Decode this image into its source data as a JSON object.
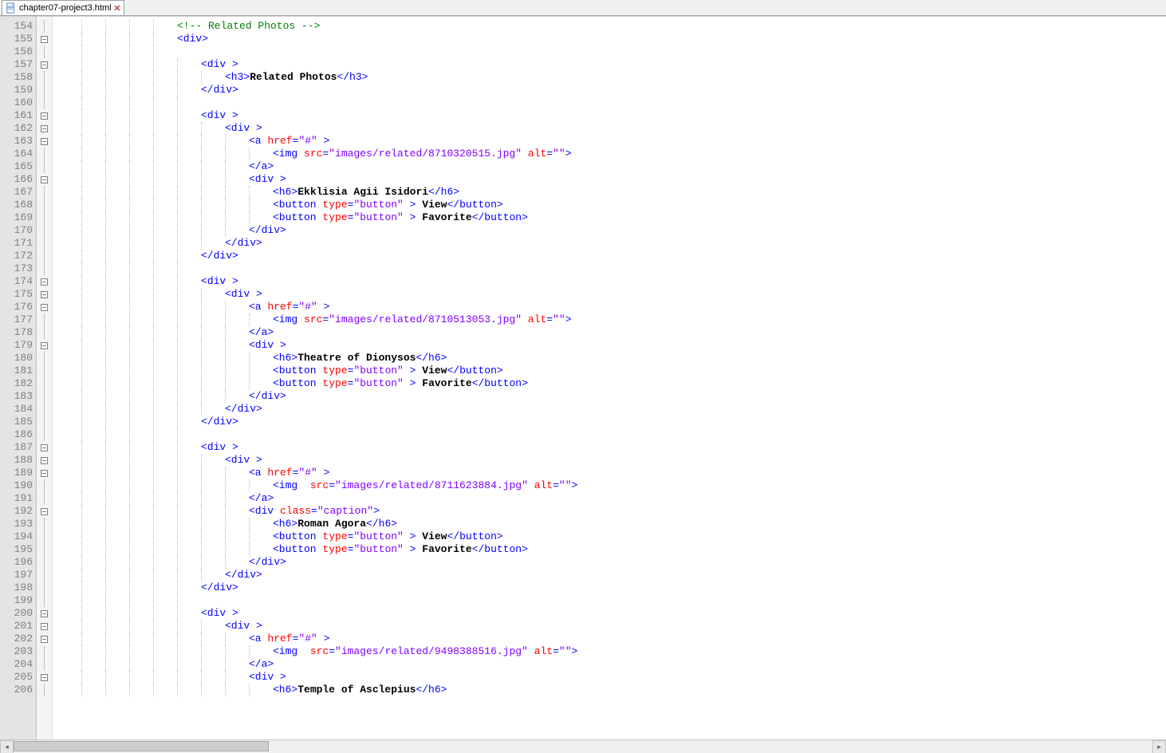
{
  "tab": {
    "filename": "chapter07-project3.html"
  },
  "first_line_number": 154,
  "lines": [
    {
      "n": 154,
      "fold": "line",
      "indent": 5,
      "tokens": [
        [
          "cmt",
          "<!-- Related Photos -->"
        ]
      ]
    },
    {
      "n": 155,
      "fold": "open",
      "indent": 5,
      "tokens": [
        [
          "tag",
          "<div>"
        ]
      ]
    },
    {
      "n": 156,
      "fold": "line",
      "indent": 5,
      "tokens": []
    },
    {
      "n": 157,
      "fold": "open",
      "indent": 6,
      "tokens": [
        [
          "tag",
          "<div "
        ],
        [
          "tag",
          ">"
        ]
      ]
    },
    {
      "n": 158,
      "fold": "line",
      "indent": 7,
      "tokens": [
        [
          "tag",
          "<h3>"
        ],
        [
          "text",
          "Related Photos"
        ],
        [
          "tag",
          "</h3>"
        ]
      ]
    },
    {
      "n": 159,
      "fold": "line",
      "indent": 6,
      "tokens": [
        [
          "tag",
          "</div>"
        ]
      ]
    },
    {
      "n": 160,
      "fold": "line",
      "indent": 6,
      "tokens": []
    },
    {
      "n": 161,
      "fold": "open",
      "indent": 6,
      "tokens": [
        [
          "tag",
          "<div "
        ],
        [
          "tag",
          ">"
        ]
      ]
    },
    {
      "n": 162,
      "fold": "open",
      "indent": 7,
      "tokens": [
        [
          "tag",
          "<div "
        ],
        [
          "tag",
          ">"
        ]
      ]
    },
    {
      "n": 163,
      "fold": "open",
      "indent": 8,
      "tokens": [
        [
          "tag",
          "<a "
        ],
        [
          "attr",
          "href"
        ],
        [
          "tag",
          "="
        ],
        [
          "val",
          "\"#\""
        ],
        [
          "tag",
          " >"
        ]
      ]
    },
    {
      "n": 164,
      "fold": "line",
      "indent": 9,
      "tokens": [
        [
          "tag",
          "<img "
        ],
        [
          "attr",
          "src"
        ],
        [
          "tag",
          "="
        ],
        [
          "val",
          "\"images/related/8710320515.jpg\""
        ],
        [
          "tag",
          " "
        ],
        [
          "attr",
          "alt"
        ],
        [
          "tag",
          "="
        ],
        [
          "val",
          "\"\""
        ],
        [
          "tag",
          ">"
        ]
      ]
    },
    {
      "n": 165,
      "fold": "line",
      "indent": 8,
      "tokens": [
        [
          "tag",
          "</a>"
        ]
      ]
    },
    {
      "n": 166,
      "fold": "open",
      "indent": 8,
      "tokens": [
        [
          "tag",
          "<div "
        ],
        [
          "tag",
          ">"
        ]
      ]
    },
    {
      "n": 167,
      "fold": "line",
      "indent": 9,
      "tokens": [
        [
          "tag",
          "<h6>"
        ],
        [
          "text",
          "Ekklisia Agii Isidori"
        ],
        [
          "tag",
          "</h6>"
        ]
      ]
    },
    {
      "n": 168,
      "fold": "line",
      "indent": 9,
      "tokens": [
        [
          "tag",
          "<button "
        ],
        [
          "attr",
          "type"
        ],
        [
          "tag",
          "="
        ],
        [
          "val",
          "\"button\""
        ],
        [
          "tag",
          " > "
        ],
        [
          "text",
          "View"
        ],
        [
          "tag",
          "</button>"
        ]
      ]
    },
    {
      "n": 169,
      "fold": "line",
      "indent": 9,
      "tokens": [
        [
          "tag",
          "<button "
        ],
        [
          "attr",
          "type"
        ],
        [
          "tag",
          "="
        ],
        [
          "val",
          "\"button\""
        ],
        [
          "tag",
          " > "
        ],
        [
          "text",
          "Favorite"
        ],
        [
          "tag",
          "</button>"
        ]
      ]
    },
    {
      "n": 170,
      "fold": "line",
      "indent": 8,
      "tokens": [
        [
          "tag",
          "</div>"
        ]
      ]
    },
    {
      "n": 171,
      "fold": "line",
      "indent": 7,
      "tokens": [
        [
          "tag",
          "</div>"
        ]
      ]
    },
    {
      "n": 172,
      "fold": "line",
      "indent": 6,
      "tokens": [
        [
          "tag",
          "</div>"
        ]
      ]
    },
    {
      "n": 173,
      "fold": "line",
      "indent": 6,
      "tokens": []
    },
    {
      "n": 174,
      "fold": "open",
      "indent": 6,
      "tokens": [
        [
          "tag",
          "<div "
        ],
        [
          "tag",
          ">"
        ]
      ]
    },
    {
      "n": 175,
      "fold": "open",
      "indent": 7,
      "tokens": [
        [
          "tag",
          "<div "
        ],
        [
          "tag",
          ">"
        ]
      ]
    },
    {
      "n": 176,
      "fold": "open",
      "indent": 8,
      "tokens": [
        [
          "tag",
          "<a "
        ],
        [
          "attr",
          "href"
        ],
        [
          "tag",
          "="
        ],
        [
          "val",
          "\"#\""
        ],
        [
          "tag",
          " >"
        ]
      ]
    },
    {
      "n": 177,
      "fold": "line",
      "indent": 9,
      "tokens": [
        [
          "tag",
          "<img "
        ],
        [
          "attr",
          "src"
        ],
        [
          "tag",
          "="
        ],
        [
          "val",
          "\"images/related/8710513053.jpg\""
        ],
        [
          "tag",
          " "
        ],
        [
          "attr",
          "alt"
        ],
        [
          "tag",
          "="
        ],
        [
          "val",
          "\"\""
        ],
        [
          "tag",
          ">"
        ]
      ]
    },
    {
      "n": 178,
      "fold": "line",
      "indent": 8,
      "tokens": [
        [
          "tag",
          "</a>"
        ]
      ]
    },
    {
      "n": 179,
      "fold": "open",
      "indent": 8,
      "tokens": [
        [
          "tag",
          "<div "
        ],
        [
          "tag",
          ">"
        ]
      ]
    },
    {
      "n": 180,
      "fold": "line",
      "indent": 9,
      "tokens": [
        [
          "tag",
          "<h6>"
        ],
        [
          "text",
          "Theatre of Dionysos"
        ],
        [
          "tag",
          "</h6>"
        ]
      ]
    },
    {
      "n": 181,
      "fold": "line",
      "indent": 9,
      "tokens": [
        [
          "tag",
          "<button "
        ],
        [
          "attr",
          "type"
        ],
        [
          "tag",
          "="
        ],
        [
          "val",
          "\"button\""
        ],
        [
          "tag",
          " > "
        ],
        [
          "text",
          "View"
        ],
        [
          "tag",
          "</button>"
        ]
      ]
    },
    {
      "n": 182,
      "fold": "line",
      "indent": 9,
      "tokens": [
        [
          "tag",
          "<button "
        ],
        [
          "attr",
          "type"
        ],
        [
          "tag",
          "="
        ],
        [
          "val",
          "\"button\""
        ],
        [
          "tag",
          " > "
        ],
        [
          "text",
          "Favorite"
        ],
        [
          "tag",
          "</button>"
        ]
      ]
    },
    {
      "n": 183,
      "fold": "line",
      "indent": 8,
      "tokens": [
        [
          "tag",
          "</div>"
        ]
      ]
    },
    {
      "n": 184,
      "fold": "line",
      "indent": 7,
      "tokens": [
        [
          "tag",
          "</div>"
        ]
      ]
    },
    {
      "n": 185,
      "fold": "line",
      "indent": 6,
      "tokens": [
        [
          "tag",
          "</div>"
        ]
      ]
    },
    {
      "n": 186,
      "fold": "line",
      "indent": 6,
      "tokens": []
    },
    {
      "n": 187,
      "fold": "open",
      "indent": 6,
      "tokens": [
        [
          "tag",
          "<div "
        ],
        [
          "tag",
          ">"
        ]
      ]
    },
    {
      "n": 188,
      "fold": "open",
      "indent": 7,
      "tokens": [
        [
          "tag",
          "<div "
        ],
        [
          "tag",
          ">"
        ]
      ]
    },
    {
      "n": 189,
      "fold": "open",
      "indent": 8,
      "tokens": [
        [
          "tag",
          "<a "
        ],
        [
          "attr",
          "href"
        ],
        [
          "tag",
          "="
        ],
        [
          "val",
          "\"#\""
        ],
        [
          "tag",
          " >"
        ]
      ]
    },
    {
      "n": 190,
      "fold": "line",
      "indent": 9,
      "tokens": [
        [
          "tag",
          "<img  "
        ],
        [
          "attr",
          "src"
        ],
        [
          "tag",
          "="
        ],
        [
          "val",
          "\"images/related/8711623884.jpg\""
        ],
        [
          "tag",
          " "
        ],
        [
          "attr",
          "alt"
        ],
        [
          "tag",
          "="
        ],
        [
          "val",
          "\"\""
        ],
        [
          "tag",
          ">"
        ]
      ]
    },
    {
      "n": 191,
      "fold": "line",
      "indent": 8,
      "tokens": [
        [
          "tag",
          "</a>"
        ]
      ]
    },
    {
      "n": 192,
      "fold": "open",
      "indent": 8,
      "tokens": [
        [
          "tag",
          "<div "
        ],
        [
          "attr",
          "class"
        ],
        [
          "tag",
          "="
        ],
        [
          "val",
          "\"caption\""
        ],
        [
          "tag",
          ">"
        ]
      ]
    },
    {
      "n": 193,
      "fold": "line",
      "indent": 9,
      "tokens": [
        [
          "tag",
          "<h6>"
        ],
        [
          "text",
          "Roman Agora"
        ],
        [
          "tag",
          "</h6>"
        ]
      ]
    },
    {
      "n": 194,
      "fold": "line",
      "indent": 9,
      "tokens": [
        [
          "tag",
          "<button "
        ],
        [
          "attr",
          "type"
        ],
        [
          "tag",
          "="
        ],
        [
          "val",
          "\"button\""
        ],
        [
          "tag",
          " > "
        ],
        [
          "text",
          "View"
        ],
        [
          "tag",
          "</button>"
        ]
      ]
    },
    {
      "n": 195,
      "fold": "line",
      "indent": 9,
      "tokens": [
        [
          "tag",
          "<button "
        ],
        [
          "attr",
          "type"
        ],
        [
          "tag",
          "="
        ],
        [
          "val",
          "\"button\""
        ],
        [
          "tag",
          " > "
        ],
        [
          "text",
          "Favorite"
        ],
        [
          "tag",
          "</button>"
        ]
      ]
    },
    {
      "n": 196,
      "fold": "line",
      "indent": 8,
      "tokens": [
        [
          "tag",
          "</div>"
        ]
      ]
    },
    {
      "n": 197,
      "fold": "line",
      "indent": 7,
      "tokens": [
        [
          "tag",
          "</div>"
        ]
      ]
    },
    {
      "n": 198,
      "fold": "line",
      "indent": 6,
      "tokens": [
        [
          "tag",
          "</div>"
        ]
      ]
    },
    {
      "n": 199,
      "fold": "line",
      "indent": 6,
      "tokens": []
    },
    {
      "n": 200,
      "fold": "open",
      "indent": 6,
      "tokens": [
        [
          "tag",
          "<div "
        ],
        [
          "tag",
          ">"
        ]
      ]
    },
    {
      "n": 201,
      "fold": "open",
      "indent": 7,
      "tokens": [
        [
          "tag",
          "<div "
        ],
        [
          "tag",
          ">"
        ]
      ]
    },
    {
      "n": 202,
      "fold": "open",
      "indent": 8,
      "tokens": [
        [
          "tag",
          "<a "
        ],
        [
          "attr",
          "href"
        ],
        [
          "tag",
          "="
        ],
        [
          "val",
          "\"#\""
        ],
        [
          "tag",
          " >"
        ]
      ]
    },
    {
      "n": 203,
      "fold": "line",
      "indent": 9,
      "tokens": [
        [
          "tag",
          "<img  "
        ],
        [
          "attr",
          "src"
        ],
        [
          "tag",
          "="
        ],
        [
          "val",
          "\"images/related/9498388516.jpg\""
        ],
        [
          "tag",
          " "
        ],
        [
          "attr",
          "alt"
        ],
        [
          "tag",
          "="
        ],
        [
          "val",
          "\"\""
        ],
        [
          "tag",
          ">"
        ]
      ]
    },
    {
      "n": 204,
      "fold": "line",
      "indent": 8,
      "tokens": [
        [
          "tag",
          "</a>"
        ]
      ]
    },
    {
      "n": 205,
      "fold": "open",
      "indent": 8,
      "tokens": [
        [
          "tag",
          "<div "
        ],
        [
          "tag",
          ">"
        ]
      ]
    },
    {
      "n": 206,
      "fold": "line",
      "indent": 9,
      "tokens": [
        [
          "tag",
          "<h6>"
        ],
        [
          "text",
          "Temple of Asclepius"
        ],
        [
          "tag",
          "</h6>"
        ]
      ]
    }
  ]
}
